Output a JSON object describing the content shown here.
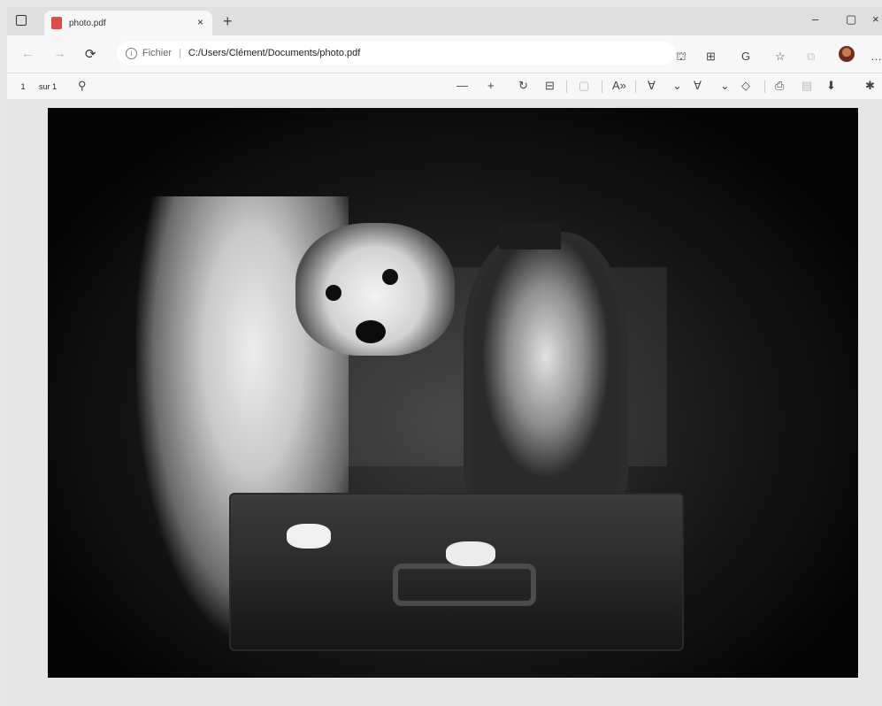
{
  "tab": {
    "title": "photo.pdf",
    "close": "×"
  },
  "new_tab": "+",
  "window": {
    "minimize": "–",
    "maximize": "▢",
    "close": "×"
  },
  "nav": {
    "back": "←",
    "forward": "→",
    "refresh": "⟳"
  },
  "address": {
    "scheme": "Fichier",
    "separator": "|",
    "url": "C:/Users/Clément/Documents/photo.pdf"
  },
  "pdf": {
    "page": "1",
    "of": "sur 1"
  },
  "icons": {
    "search": "⚲",
    "zoom_out": "—",
    "zoom_in": "+",
    "rotate": "↻",
    "fit": "⊟",
    "read_aloud": "A»",
    "draw": "∀",
    "highlight": "∀",
    "erase": "◇",
    "print": "⎙",
    "save": "⬇",
    "favorites": "☆",
    "collections": "⧉",
    "extensions": "⊞"
  }
}
